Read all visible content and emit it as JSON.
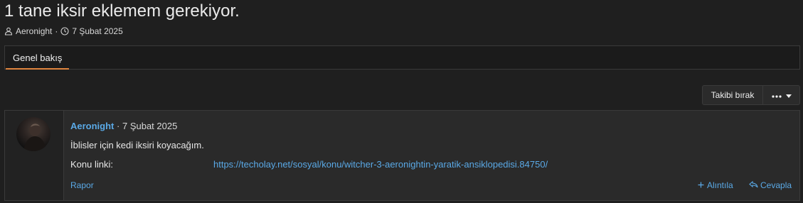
{
  "thread": {
    "title": "1 tane iksir eklemem gerekiyor.",
    "author": "Aeronight",
    "separator": "·",
    "date": "7 Şubat 2025"
  },
  "tabs": [
    {
      "label": "Genel bakış",
      "active": true
    }
  ],
  "actions": {
    "follow_label": "Takibi bırak",
    "more_icon": "ellipsis-icon"
  },
  "post": {
    "author": "Aeronight",
    "separator": "·",
    "date": "7 Şubat 2025",
    "body": "İblisler için kedi iksiri koyacağım.",
    "link_label": "Konu linki:",
    "link_url": "https://techolay.net/sosyal/konu/witcher-3-aeronightin-yaratik-ansiklopedisi.84750/",
    "report_label": "Rapor",
    "quote_label": "Alıntıla",
    "reply_label": "Cevapla"
  },
  "colors": {
    "background": "#1f1f1f",
    "panel": "#2a2a2a",
    "link": "#5aa9e6",
    "tab_accent": "#e0853e"
  }
}
